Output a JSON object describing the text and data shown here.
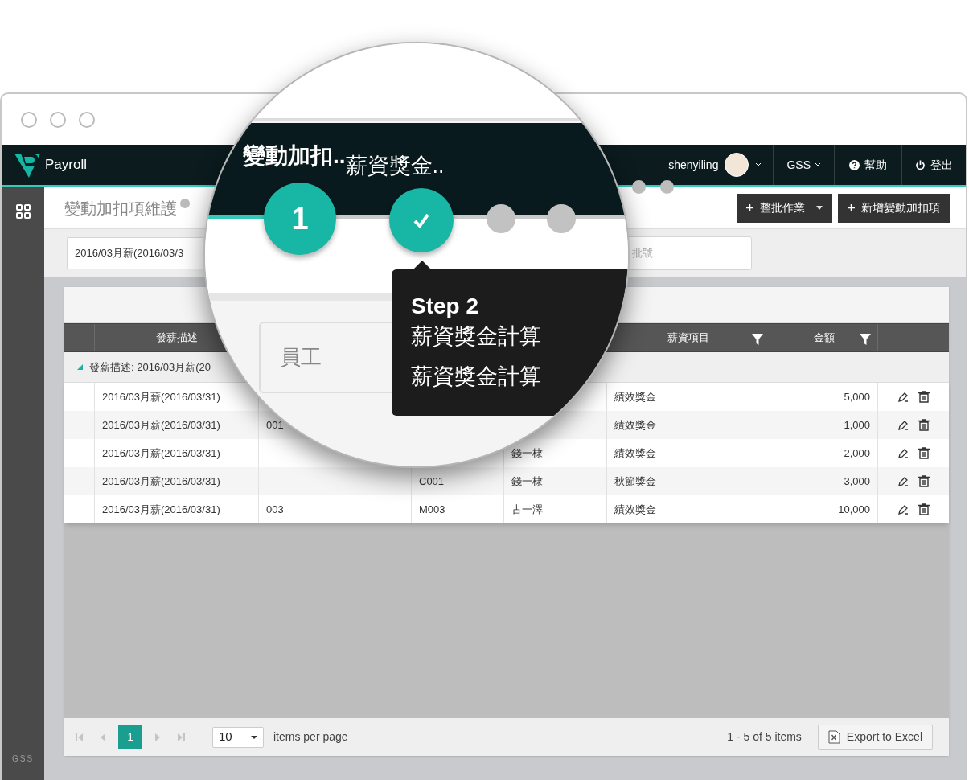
{
  "header": {
    "app_name": "Payroll",
    "user": "shenyiling",
    "company": "GSS",
    "help": "幫助",
    "logout": "登出"
  },
  "sidebar": {
    "footer": "GSS"
  },
  "page": {
    "title": "變動加扣項維護",
    "actions": [
      {
        "label": "整批作業",
        "dropdown": true
      },
      {
        "label": "新增變動加扣項",
        "dropdown": false
      }
    ]
  },
  "filters": {
    "period": "2016/03月薪(2016/03/3",
    "batch_placeholder": "批號"
  },
  "table": {
    "columns": [
      {
        "label": "發薪描述"
      },
      null,
      null,
      null,
      {
        "label": "薪資項目",
        "filter": true
      },
      {
        "label": "金額",
        "filter": true
      }
    ],
    "group": {
      "label": "發薪描述: 2016/03月薪(20",
      "expanded": true
    },
    "rows": [
      {
        "cells": [
          "2016/03月薪(2016/03/31)",
          null,
          null,
          null,
          "績效獎金",
          "5,000"
        ]
      },
      {
        "cells": [
          "2016/03月薪(2016/03/31)",
          "001",
          null,
          null,
          "績效獎金",
          "1,000"
        ]
      },
      {
        "cells": [
          "2016/03月薪(2016/03/31)",
          null,
          null,
          "錢一棣",
          "績效獎金",
          "2,000"
        ]
      },
      {
        "cells": [
          "2016/03月薪(2016/03/31)",
          null,
          "C001",
          "錢一棣",
          "秋節獎金",
          "3,000"
        ]
      },
      {
        "cells": [
          "2016/03月薪(2016/03/31)",
          "003",
          "M003",
          "古一澤",
          "績效獎金",
          "10,000"
        ]
      }
    ]
  },
  "pager": {
    "pages": [
      {
        "label": "1",
        "selected": true
      }
    ],
    "page_size": "10",
    "page_size_label": "items per page",
    "summary": "1 - 5 of 5 items",
    "export": "Export to Excel"
  },
  "magnifier": {
    "breadcrumbs": [
      {
        "label": "變動加扣..",
        "active": true
      },
      {
        "label": "薪資獎金..",
        "active": false
      }
    ],
    "steps": [
      {
        "kind": "number",
        "label": "1"
      },
      {
        "kind": "check"
      },
      {
        "kind": "pending"
      },
      {
        "kind": "pending"
      }
    ],
    "tooltip": {
      "title": "Step 2",
      "lines": [
        "薪資獎金計算",
        "薪資獎金計算"
      ]
    },
    "field_label": "員工"
  }
}
